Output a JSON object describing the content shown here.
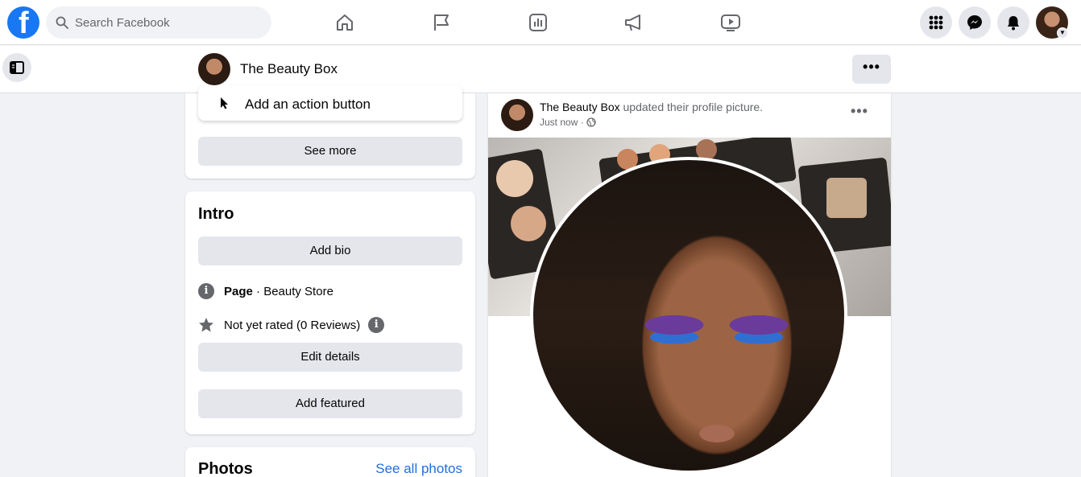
{
  "topbar": {
    "logo_letter": "f",
    "search_placeholder": "Search Facebook",
    "nav_icons": [
      "home-icon",
      "flag-icon",
      "insights-icon",
      "megaphone-icon",
      "video-icon"
    ],
    "right_icons": [
      "menu-grid-icon",
      "messenger-icon",
      "bell-icon"
    ]
  },
  "subbar": {
    "page_name": "The Beauty Box",
    "more_label": "•••"
  },
  "left": {
    "action_button_label": "Add an action button",
    "see_more_label": "See more",
    "intro": {
      "title": "Intro",
      "add_bio_label": "Add bio",
      "page_type_bold": "Page",
      "page_type_rest": " · Beauty Store",
      "rating_text": "Not yet rated (0 Reviews)",
      "edit_details_label": "Edit details",
      "add_featured_label": "Add featured"
    },
    "photos": {
      "title": "Photos",
      "see_all_label": "See all photos"
    }
  },
  "post": {
    "author": "The Beauty Box",
    "action": " updated their profile picture.",
    "time": "Just now ·",
    "more_label": "•••"
  },
  "colors": {
    "brand": "#1877f2",
    "link": "#216fdb",
    "button_gray": "#e4e6eb"
  }
}
